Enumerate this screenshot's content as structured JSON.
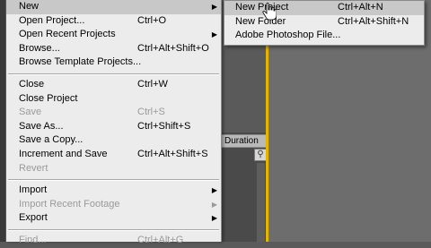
{
  "background": {
    "duration_header": "Duration",
    "timeline_icon": "⚲"
  },
  "menu": {
    "items": [
      {
        "label": "New",
        "shortcut": "",
        "submenu": true,
        "disabled": false,
        "highlight": true
      },
      {
        "label": "Open Project...",
        "shortcut": "Ctrl+O",
        "submenu": false,
        "disabled": false
      },
      {
        "label": "Open Recent Projects",
        "shortcut": "",
        "submenu": true,
        "disabled": false
      },
      {
        "label": "Browse...",
        "shortcut": "Ctrl+Alt+Shift+O",
        "submenu": false,
        "disabled": false
      },
      {
        "label": "Browse Template Projects...",
        "shortcut": "",
        "submenu": false,
        "disabled": false
      },
      {
        "separator": true
      },
      {
        "label": "Close",
        "shortcut": "Ctrl+W",
        "submenu": false,
        "disabled": false
      },
      {
        "label": "Close Project",
        "shortcut": "",
        "submenu": false,
        "disabled": false
      },
      {
        "label": "Save",
        "shortcut": "Ctrl+S",
        "submenu": false,
        "disabled": true
      },
      {
        "label": "Save As...",
        "shortcut": "Ctrl+Shift+S",
        "submenu": false,
        "disabled": false
      },
      {
        "label": "Save a Copy...",
        "shortcut": "",
        "submenu": false,
        "disabled": false
      },
      {
        "label": "Increment and Save",
        "shortcut": "Ctrl+Alt+Shift+S",
        "submenu": false,
        "disabled": false
      },
      {
        "label": "Revert",
        "shortcut": "",
        "submenu": false,
        "disabled": true
      },
      {
        "separator": true
      },
      {
        "label": "Import",
        "shortcut": "",
        "submenu": true,
        "disabled": false
      },
      {
        "label": "Import Recent Footage",
        "shortcut": "",
        "submenu": true,
        "disabled": true
      },
      {
        "label": "Export",
        "shortcut": "",
        "submenu": true,
        "disabled": false
      },
      {
        "separator": true
      },
      {
        "label": "Find...",
        "shortcut": "Ctrl+Alt+G",
        "submenu": false,
        "disabled": true
      }
    ]
  },
  "submenu": {
    "items": [
      {
        "label": "New Project",
        "shortcut": "Ctrl+Alt+N",
        "highlight": true
      },
      {
        "label": "New Folder",
        "shortcut": "Ctrl+Alt+Shift+N",
        "highlight": false
      },
      {
        "label": "Adobe Photoshop File...",
        "shortcut": "",
        "highlight": false
      }
    ]
  },
  "icons": {
    "submenu_arrow": "▶"
  }
}
